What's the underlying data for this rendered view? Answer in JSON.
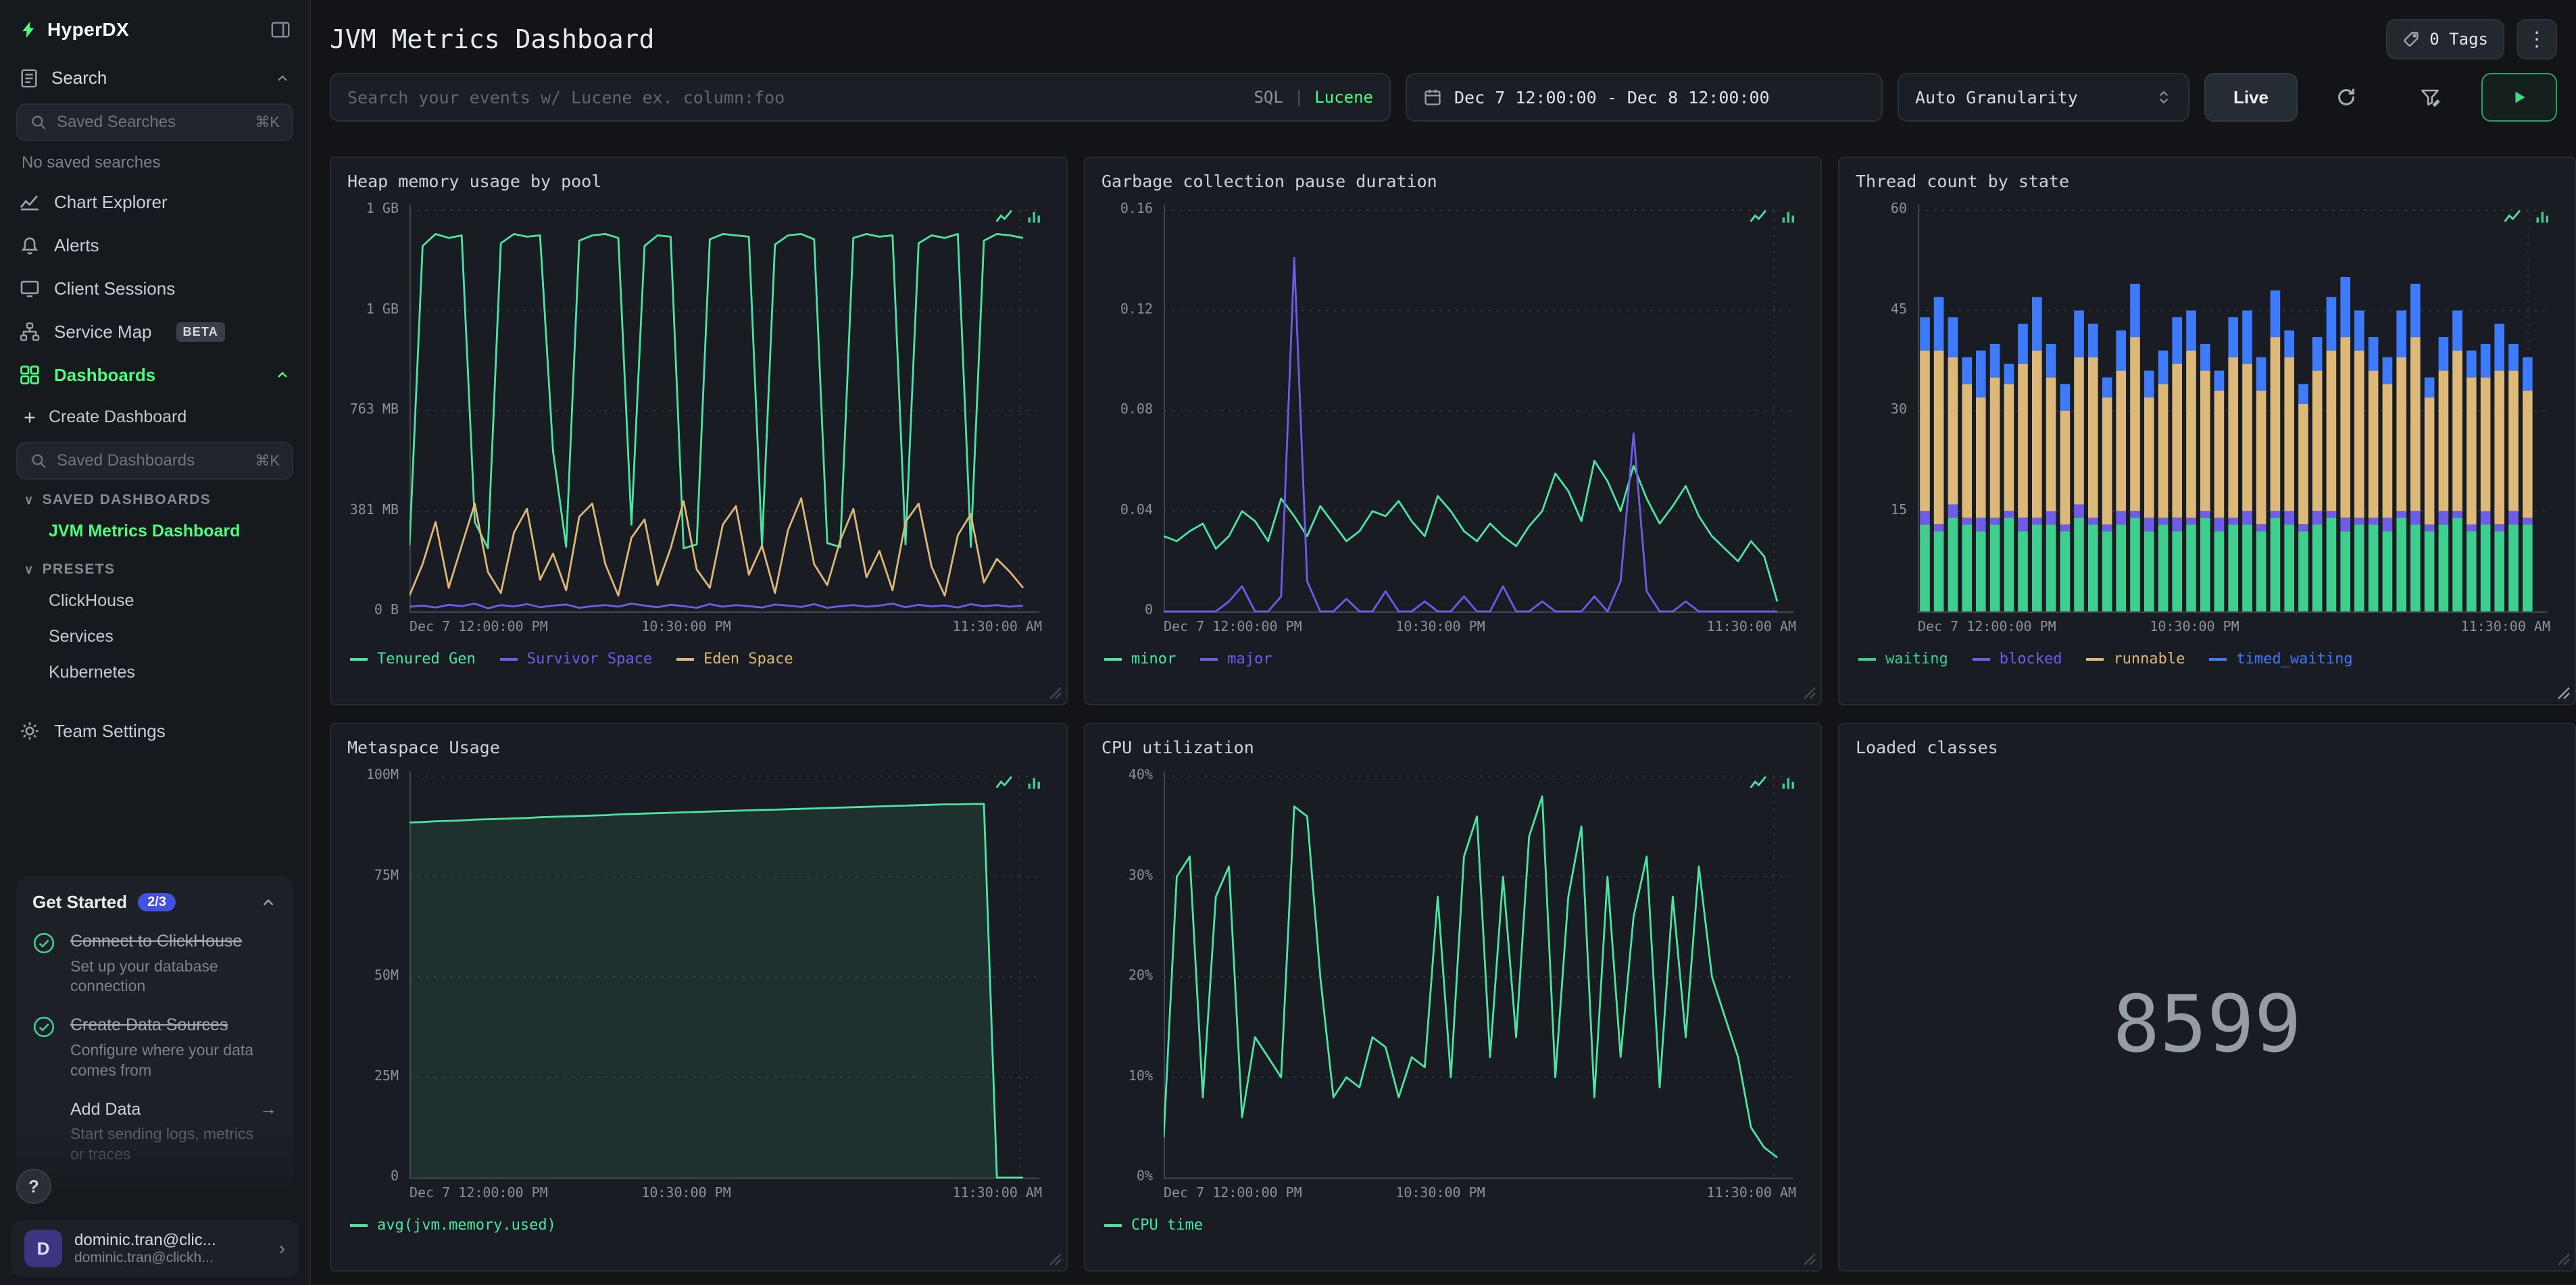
{
  "app": {
    "name": "HyperDX"
  },
  "sidebar": {
    "search_section": {
      "label": "Search"
    },
    "saved_searches_input": {
      "placeholder": "Saved Searches",
      "shortcut": "⌘K"
    },
    "no_saved": "No saved searches",
    "nav": [
      {
        "label": "Chart Explorer"
      },
      {
        "label": "Alerts"
      },
      {
        "label": "Client Sessions"
      },
      {
        "label": "Service Map",
        "badge": "BETA"
      },
      {
        "label": "Dashboards"
      }
    ],
    "create_dashboard": "Create Dashboard",
    "saved_dashboards_input": {
      "placeholder": "Saved Dashboards",
      "shortcut": "⌘K"
    },
    "saved_dashboards_header": "SAVED DASHBOARDS",
    "saved_dashboards": [
      {
        "label": "JVM Metrics Dashboard"
      }
    ],
    "presets_header": "PRESETS",
    "presets": [
      "ClickHouse",
      "Services",
      "Kubernetes"
    ],
    "team_settings": "Team Settings",
    "get_started": {
      "title": "Get Started",
      "progress": "2/3",
      "steps": [
        {
          "title": "Connect to ClickHouse",
          "subtitle": "Set up your database connection",
          "done": true
        },
        {
          "title": "Create Data Sources",
          "subtitle": "Configure where your data comes from",
          "done": true
        },
        {
          "title": "Add Data",
          "subtitle": "Start sending logs, metrics or traces",
          "done": false
        }
      ]
    },
    "user": {
      "initial": "D",
      "name": "dominic.tran@clic...",
      "email": "dominic.tran@clickh..."
    }
  },
  "header": {
    "title": "JVM Metrics Dashboard",
    "tags_button": "0 Tags"
  },
  "toolbar": {
    "search_placeholder": "Search your events w/ Lucene ex. column:foo",
    "lang_sql": "SQL",
    "lang_divider": "|",
    "lang_lucene": "Lucene",
    "date_range": "Dec 7 12:00:00 - Dec 8 12:00:00",
    "granularity": "Auto Granularity",
    "live_label": "Live"
  },
  "chart_data": [
    {
      "id": "heap-memory",
      "type": "line",
      "title": "Heap memory usage by pool",
      "unit": "MB",
      "ylim": [
        0,
        1526
      ],
      "yticks": [
        {
          "v": 0,
          "label": "0 B"
        },
        {
          "v": 381,
          "label": "381 MB"
        },
        {
          "v": 763,
          "label": "763 MB"
        },
        {
          "v": 1144,
          "label": "1 GB"
        },
        {
          "v": 1526,
          "label": "1 GB"
        }
      ],
      "x_ticks": [
        {
          "label": "Dec 7 12:00:00 PM",
          "pos": 0
        },
        {
          "label": "10:30:00 PM",
          "pos": 0.4375
        },
        {
          "label": "11:30:00 AM",
          "pos": 0.979
        }
      ],
      "series": [
        {
          "name": "Tenured Gen",
          "color": "#4fe3a1",
          "values": [
            250,
            1390,
            1435,
            1420,
            1430,
            340,
            240,
            1400,
            1435,
            1425,
            1430,
            610,
            245,
            1410,
            1430,
            1435,
            1420,
            330,
            1390,
            1430,
            1425,
            240,
            255,
            1415,
            1435,
            1430,
            1425,
            250,
            1395,
            1430,
            1435,
            1415,
            260,
            245,
            1420,
            1435,
            1425,
            1430,
            255,
            1400,
            1430,
            1420,
            1435,
            245,
            1410,
            1435,
            1430,
            1420
          ]
        },
        {
          "name": "Survivor Space",
          "color": "#6f5ce8",
          "values": [
            18,
            22,
            15,
            25,
            20,
            30,
            12,
            24,
            19,
            28,
            16,
            22,
            26,
            14,
            20,
            24,
            18,
            30,
            22,
            16,
            25,
            20,
            14,
            28,
            18,
            24,
            20,
            15,
            26,
            22,
            17,
            28,
            14,
            20,
            24,
            18,
            22,
            30,
            16,
            25,
            19,
            23,
            15,
            27,
            20,
            24,
            18,
            22
          ]
        },
        {
          "name": "Eden Space",
          "color": "#dcb879",
          "values": [
            60,
            180,
            340,
            90,
            250,
            410,
            150,
            70,
            300,
            390,
            120,
            220,
            80,
            360,
            410,
            180,
            60,
            280,
            350,
            100,
            240,
            420,
            160,
            90,
            330,
            400,
            140,
            250,
            70,
            310,
            430,
            180,
            100,
            270,
            390,
            130,
            230,
            80,
            340,
            410,
            170,
            60,
            290,
            370,
            110,
            200,
            150,
            90
          ]
        }
      ]
    },
    {
      "id": "gc-pause",
      "type": "line",
      "title": "Garbage collection pause duration",
      "unit": "s",
      "ylim": [
        0,
        0.16
      ],
      "yticks": [
        {
          "v": 0,
          "label": "0"
        },
        {
          "v": 0.04,
          "label": "0.04"
        },
        {
          "v": 0.08,
          "label": "0.08"
        },
        {
          "v": 0.12,
          "label": "0.12"
        },
        {
          "v": 0.16,
          "label": "0.16"
        }
      ],
      "x_ticks": [
        {
          "label": "Dec 7 12:00:00 PM",
          "pos": 0
        },
        {
          "label": "10:30:00 PM",
          "pos": 0.4375
        },
        {
          "label": "11:30:00 AM",
          "pos": 0.979
        }
      ],
      "series": [
        {
          "name": "minor",
          "color": "#4fe3a1",
          "values": [
            0.03,
            0.028,
            0.032,
            0.035,
            0.025,
            0.03,
            0.04,
            0.036,
            0.028,
            0.045,
            0.038,
            0.03,
            0.042,
            0.035,
            0.028,
            0.032,
            0.04,
            0.038,
            0.044,
            0.036,
            0.03,
            0.046,
            0.04,
            0.032,
            0.028,
            0.035,
            0.03,
            0.026,
            0.034,
            0.04,
            0.055,
            0.048,
            0.036,
            0.06,
            0.052,
            0.04,
            0.058,
            0.045,
            0.035,
            0.042,
            0.05,
            0.038,
            0.03,
            0.025,
            0.02,
            0.028,
            0.022,
            0.004
          ]
        },
        {
          "name": "major",
          "color": "#6f5ce8",
          "values": [
            0,
            0,
            0,
            0,
            0,
            0.004,
            0.01,
            0,
            0,
            0.006,
            0.141,
            0.012,
            0,
            0,
            0.005,
            0,
            0,
            0.008,
            0,
            0,
            0.004,
            0,
            0,
            0.006,
            0,
            0,
            0.01,
            0,
            0,
            0.004,
            0,
            0,
            0,
            0.006,
            0,
            0.012,
            0.071,
            0.008,
            0,
            0,
            0.004,
            0,
            0,
            0,
            0,
            0,
            0,
            0
          ]
        }
      ]
    },
    {
      "id": "thread-count",
      "type": "stacked_bar",
      "title": "Thread count by state",
      "unit": "threads",
      "ylim": [
        0,
        60
      ],
      "yticks": [
        {
          "v": 15,
          "label": "15"
        },
        {
          "v": 30,
          "label": "30"
        },
        {
          "v": 45,
          "label": "45"
        },
        {
          "v": 60,
          "label": "60"
        }
      ],
      "x_ticks": [
        {
          "label": "Dec 7 12:00:00 PM",
          "pos": 0
        },
        {
          "label": "10:30:00 PM",
          "pos": 0.4375
        },
        {
          "label": "11:30:00 AM",
          "pos": 0.979
        }
      ],
      "series": [
        {
          "name": "waiting",
          "color": "#3ecf8e",
          "values": [
            13,
            12,
            14,
            13,
            12,
            13,
            14,
            12,
            13,
            13,
            12,
            14,
            13,
            12,
            13,
            14,
            12,
            13,
            12,
            13,
            14,
            12,
            13,
            13,
            12,
            14,
            13,
            12,
            13,
            14,
            12,
            13,
            13,
            12,
            14,
            13,
            12,
            13,
            14,
            12,
            13,
            12,
            13,
            13
          ]
        },
        {
          "name": "blocked",
          "color": "#6f5ce8",
          "values": [
            2,
            1,
            2,
            1,
            2,
            1,
            1,
            2,
            1,
            2,
            1,
            2,
            1,
            1,
            2,
            1,
            2,
            1,
            2,
            1,
            1,
            2,
            1,
            2,
            1,
            1,
            2,
            1,
            2,
            1,
            2,
            1,
            1,
            2,
            1,
            2,
            1,
            2,
            1,
            1,
            2,
            1,
            2,
            1
          ]
        },
        {
          "name": "runnable",
          "color": "#dcb879",
          "values": [
            24,
            26,
            22,
            20,
            18,
            21,
            19,
            23,
            25,
            20,
            17,
            22,
            24,
            19,
            21,
            26,
            18,
            20,
            23,
            25,
            21,
            19,
            24,
            22,
            20,
            26,
            23,
            18,
            21,
            24,
            27,
            25,
            22,
            20,
            23,
            26,
            19,
            21,
            24,
            22,
            20,
            23,
            21,
            19
          ]
        },
        {
          "name": "timed_waiting",
          "color": "#3e7bfa",
          "values": [
            5,
            8,
            6,
            4,
            7,
            5,
            3,
            6,
            8,
            5,
            4,
            7,
            5,
            3,
            6,
            8,
            4,
            5,
            7,
            6,
            4,
            3,
            6,
            8,
            5,
            7,
            4,
            3,
            5,
            8,
            9,
            6,
            5,
            4,
            7,
            8,
            3,
            5,
            6,
            4,
            5,
            7,
            4,
            5
          ]
        }
      ]
    },
    {
      "id": "metaspace",
      "type": "line",
      "fill": true,
      "title": "Metaspace Usage",
      "unit": "bytes",
      "ylim": [
        0,
        100
      ],
      "yticks": [
        {
          "v": 0,
          "label": "0"
        },
        {
          "v": 25,
          "label": "25M"
        },
        {
          "v": 50,
          "label": "50M"
        },
        {
          "v": 75,
          "label": "75M"
        },
        {
          "v": 100,
          "label": "100M"
        }
      ],
      "x_ticks": [
        {
          "label": "Dec 7 12:00:00 PM",
          "pos": 0
        },
        {
          "label": "10:30:00 PM",
          "pos": 0.4375
        },
        {
          "label": "11:30:00 AM",
          "pos": 0.979
        }
      ],
      "series": [
        {
          "name": "avg(jvm.memory.used)",
          "color": "#4fe3a1",
          "values": [
            88.5,
            88.6,
            88.8,
            88.9,
            89.0,
            89.2,
            89.3,
            89.4,
            89.5,
            89.6,
            89.8,
            89.9,
            90.0,
            90.1,
            90.2,
            90.3,
            90.5,
            90.6,
            90.7,
            90.8,
            90.9,
            91.0,
            91.1,
            91.2,
            91.3,
            91.4,
            91.5,
            91.6,
            91.7,
            91.8,
            91.9,
            92.0,
            92.1,
            92.2,
            92.3,
            92.4,
            92.5,
            92.6,
            92.7,
            92.8,
            92.9,
            93.0,
            93.0,
            93.1,
            93.1,
            0,
            0,
            0
          ]
        }
      ]
    },
    {
      "id": "cpu-utilization",
      "type": "line",
      "title": "CPU utilization",
      "unit": "%",
      "ylim": [
        0,
        40
      ],
      "yticks": [
        {
          "v": 0,
          "label": "0%"
        },
        {
          "v": 10,
          "label": "10%"
        },
        {
          "v": 20,
          "label": "20%"
        },
        {
          "v": 30,
          "label": "30%"
        },
        {
          "v": 40,
          "label": "40%"
        }
      ],
      "x_ticks": [
        {
          "label": "Dec 7 12:00:00 PM",
          "pos": 0
        },
        {
          "label": "10:30:00 PM",
          "pos": 0.4375
        },
        {
          "label": "11:30:00 AM",
          "pos": 0.979
        }
      ],
      "series": [
        {
          "name": "CPU time",
          "color": "#4fe3a1",
          "values": [
            4,
            30,
            32,
            8,
            28,
            31,
            6,
            14,
            12,
            10,
            37,
            36,
            20,
            8,
            10,
            9,
            14,
            13,
            8,
            12,
            11,
            28,
            10,
            32,
            36,
            12,
            30,
            14,
            34,
            38,
            10,
            28,
            35,
            8,
            30,
            12,
            26,
            32,
            9,
            28,
            14,
            31,
            20,
            16,
            12,
            5,
            3,
            2
          ]
        }
      ]
    },
    {
      "id": "loaded-classes",
      "type": "number",
      "title": "Loaded classes",
      "value": "8599"
    }
  ]
}
